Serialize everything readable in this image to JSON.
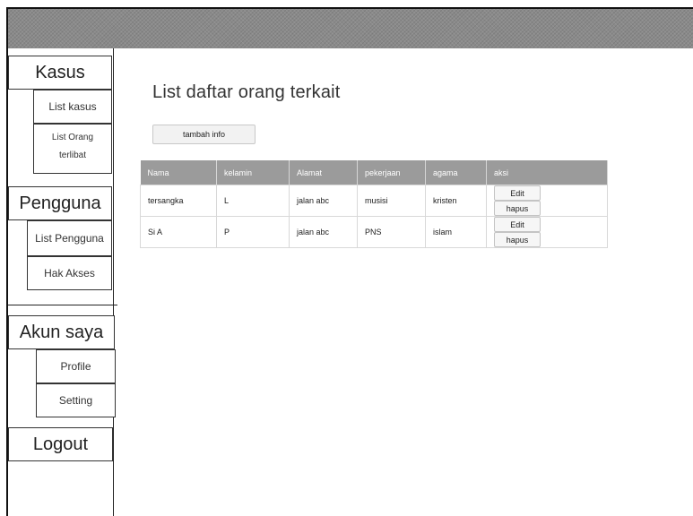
{
  "sidebar": {
    "kasus": {
      "title": "Kasus",
      "list_kasus": "List kasus",
      "list_orang_line1": "List Orang",
      "list_orang_line2": "terlibat"
    },
    "pengguna": {
      "title": "Pengguna",
      "list_pengguna": "List Pengguna",
      "hak_akses": "Hak Akses"
    },
    "akun": {
      "title": "Akun saya",
      "profile": "Profile",
      "setting": "Setting"
    },
    "logout": "Logout"
  },
  "main": {
    "title": "List daftar orang terkait",
    "add_button": "tambah info",
    "table": {
      "headers": [
        "Nama",
        "kelamin",
        "Alamat",
        "pekerjaan",
        "agama",
        "aksi"
      ],
      "rows": [
        {
          "nama": "tersangka",
          "kelamin": "L",
          "alamat": "jalan abc",
          "pekerjaan": "musisi",
          "agama": "kristen",
          "edit": "Edit",
          "hapus": "hapus"
        },
        {
          "nama": "Si A",
          "kelamin": "P",
          "alamat": "jalan abc",
          "pekerjaan": "PNS",
          "agama": "islam",
          "edit": "Edit",
          "hapus": "hapus"
        }
      ]
    }
  }
}
